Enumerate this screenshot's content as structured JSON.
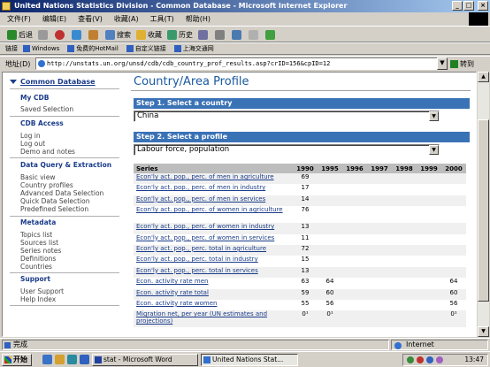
{
  "window": {
    "title": "United Nations Statistics Division - Common Database - Microsoft Internet Explorer"
  },
  "menu": [
    "文件(F)",
    "编辑(E)",
    "查看(V)",
    "收藏(A)",
    "工具(T)",
    "帮助(H)"
  ],
  "toolbar": {
    "back": "后退",
    "search": "搜索",
    "favorites": "收藏",
    "history": "历史"
  },
  "links": {
    "label": "链接",
    "items": [
      "Windows",
      "免费的HotMail",
      "自定义链接",
      "上海交通网"
    ]
  },
  "address": {
    "label": "地址(D)",
    "url": "http://unstats.un.org/unsd/cdb/cdb_country_prof_results.asp?crID=156&cpID=12",
    "go": "转到"
  },
  "sidebar": {
    "top": "Common Database",
    "sections": [
      {
        "head": "My CDB",
        "items": [
          "Saved Selection"
        ]
      },
      {
        "head": "CDB Access",
        "items": [
          "Log in",
          "Log out",
          "Demo and notes"
        ]
      },
      {
        "head": "Data Query & Extraction",
        "items": [
          "Basic view",
          "Country profiles",
          "Advanced Data Selection",
          "Quick Data Selection",
          "Predefined Selection"
        ]
      },
      {
        "head": "Metadata",
        "items": [
          "Topics list",
          "Sources list",
          "Series notes",
          "Definitions",
          "Countries"
        ]
      },
      {
        "head": "Support",
        "items": [
          "User Support",
          "Help Index"
        ]
      }
    ]
  },
  "main": {
    "title": "Country/Area Profile",
    "step1": "Step 1. Select a country",
    "country": "China",
    "step2": "Step 2. Select a profile",
    "profile": "Labour force, population"
  },
  "table": {
    "headers": [
      "Series",
      "1990",
      "1995",
      "1996",
      "1997",
      "1998",
      "1999",
      "2000"
    ],
    "rows": [
      {
        "series": "Econ'ly act. pop., perc. of men in agriculture",
        "values": [
          "69",
          "",
          "",
          "",
          "",
          "",
          ""
        ]
      },
      {
        "series": "Econ'ly act. pop., perc. of men in industry",
        "values": [
          "17",
          "",
          "",
          "",
          "",
          "",
          ""
        ]
      },
      {
        "series": "Econ'ly act. pop., perc. of men in services",
        "values": [
          "14",
          "",
          "",
          "",
          "",
          "",
          ""
        ]
      },
      {
        "series": "Econ'ly act. pop., perc. of women in agriculture",
        "values": [
          "76",
          "",
          "",
          "",
          "",
          "",
          ""
        ]
      },
      {
        "series": "Econ'ly act. pop., perc. of women in industry",
        "values": [
          "13",
          "",
          "",
          "",
          "",
          "",
          ""
        ]
      },
      {
        "series": "Econ'ly act. pop., perc. of women in services",
        "values": [
          "11",
          "",
          "",
          "",
          "",
          "",
          ""
        ]
      },
      {
        "series": "Econ'ly act. pop., perc. total in agriculture",
        "values": [
          "72",
          "",
          "",
          "",
          "",
          "",
          ""
        ]
      },
      {
        "series": "Econ'ly act. pop., perc. total in industry",
        "values": [
          "15",
          "",
          "",
          "",
          "",
          "",
          ""
        ]
      },
      {
        "series": "Econ'ly act. pop., perc. total in services",
        "values": [
          "13",
          "",
          "",
          "",
          "",
          "",
          ""
        ]
      },
      {
        "series": "Econ. activity rate men",
        "values": [
          "63",
          "64",
          "",
          "",
          "",
          "",
          "64"
        ]
      },
      {
        "series": "Econ. activity rate total",
        "values": [
          "59",
          "60",
          "",
          "",
          "",
          "",
          "60"
        ]
      },
      {
        "series": "Econ. activity rate women",
        "values": [
          "55",
          "56",
          "",
          "",
          "",
          "",
          "56"
        ]
      },
      {
        "series": "Migration net, per year (UN estimates and projections)",
        "values": [
          "0¹",
          "0¹",
          "",
          "",
          "",
          "",
          "0¹"
        ]
      }
    ]
  },
  "status": {
    "text": "完成",
    "zone": "Internet"
  },
  "taskbar": {
    "start": "开始",
    "tasks": [
      "stat - Microsoft Word",
      "United Nations Stat..."
    ],
    "clock": "13:47"
  }
}
